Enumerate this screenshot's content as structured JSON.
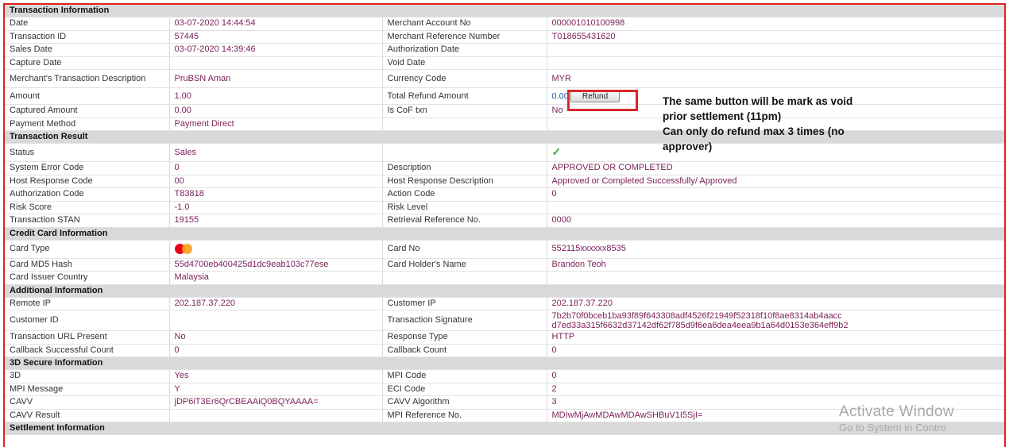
{
  "sections": {
    "transaction_info": "Transaction Information",
    "transaction_result": "Transaction Result",
    "credit_card": "Credit Card Information",
    "additional": "Additional Information",
    "secure3d": "3D Secure Information",
    "settlement": "Settlement Information"
  },
  "tx": {
    "date_label": "Date",
    "date": "03-07-2020 14:44:54",
    "merchant_acct_label": "Merchant Account No",
    "merchant_acct": "000001010100998",
    "txid_label": "Transaction ID",
    "txid": "57445",
    "merchant_ref_label": "Merchant Reference Number",
    "merchant_ref": "T018655431620",
    "sales_date_label": "Sales Date",
    "sales_date": "03-07-2020 14:39:46",
    "auth_date_label": "Authorization Date",
    "auth_date": "",
    "capture_date_label": "Capture Date",
    "capture_date": "",
    "void_date_label": "Void Date",
    "void_date": "",
    "desc_label": "Merchant's Transaction Description",
    "desc": "PruBSN Aman",
    "currency_label": "Currency Code",
    "currency": "MYR",
    "amount_label": "Amount",
    "amount": "1.00",
    "refund_total_label": "Total Refund Amount",
    "refund_total": "0.00",
    "refund_button": "Refund",
    "captured_label": "Captured Amount",
    "captured": "0.00",
    "cof_label": "Is CoF txn",
    "cof": "No",
    "pay_method_label": "Payment Method",
    "pay_method": "Payment Direct"
  },
  "result": {
    "status_label": "Status",
    "status": "Sales",
    "status_icon": "check-icon",
    "sys_err_label": "System Error Code",
    "sys_err": "0",
    "description_label": "Description",
    "description": "APPROVED OR COMPLETED",
    "host_code_label": "Host Response Code",
    "host_code": "00",
    "host_desc_label": "Host Response Description",
    "host_desc": "Approved or Completed Successfully/ Approved",
    "auth_code_label": "Authorization Code",
    "auth_code": "T83818",
    "action_code_label": "Action Code",
    "action_code": "0",
    "risk_score_label": "Risk Score",
    "risk_score": "-1.0",
    "risk_level_label": "Risk Level",
    "risk_level": "",
    "stan_label": "Transaction STAN",
    "stan": "19155",
    "rrn_label": "Retrieval Reference No.",
    "rrn": "0000"
  },
  "card": {
    "type_label": "Card Type",
    "type_icon": "mastercard-icon",
    "no_label": "Card No",
    "no": "552115xxxxxx8535",
    "md5_label": "Card MD5 Hash",
    "md5": "55d4700eb400425d1dc9eab103c77ese",
    "holder_label": "Card Holder's Name",
    "holder": "Brandon Teoh",
    "issuer_label": "Card Issuer Country",
    "issuer": "Malaysia"
  },
  "additional": {
    "remote_ip_label": "Remote IP",
    "remote_ip": "202.187.37.220",
    "cust_ip_label": "Customer IP",
    "cust_ip": "202.187.37.220",
    "cust_id_label": "Customer ID",
    "cust_id": "",
    "sig_label": "Transaction Signature",
    "sig1": "7b2b70f0bceb1ba93f89f643308adf4526f21949f52318f10f8ae8314ab4aacc",
    "sig2": "d7ed33a315f6632d37142df62f785d9f6ea6dea4eea9b1a64d0153e364eff9b2",
    "url_label": "Transaction URL Present",
    "url": "No",
    "resp_type_label": "Response Type",
    "resp_type": "HTTP",
    "cb_success_label": "Callback Successful Count",
    "cb_success": "0",
    "cb_count_label": "Callback Count",
    "cb_count": "0"
  },
  "secure3d": {
    "three_d_label": "3D",
    "three_d": "Yes",
    "mpi_code_label": "MPI Code",
    "mpi_code": "0",
    "mpi_msg_label": "MPI Message",
    "mpi_msg": "Y",
    "eci_label": "ECI Code",
    "eci": "2",
    "cavv_label": "CAVV",
    "cavv": "jDP6iT3Er6QrCBEAAiQ0BQYAAAA=",
    "cavv_algo_label": "CAVV Algorithm",
    "cavv_algo": "3",
    "cavv_result_label": "CAVV Result",
    "cavv_result": "",
    "mpi_ref_label": "MPI Reference No.",
    "mpi_ref": "MDIwMjAwMDAwMDAwSHBuV1I5SjI="
  },
  "annotation": {
    "line1": "The same button will be mark as void",
    "line2": "prior settlement (11pm)",
    "line3": "Can only do refund max 3 times (no",
    "line4": "approver)"
  },
  "watermark": {
    "line1": "Activate Window",
    "line2": "Go to System in Contro"
  }
}
